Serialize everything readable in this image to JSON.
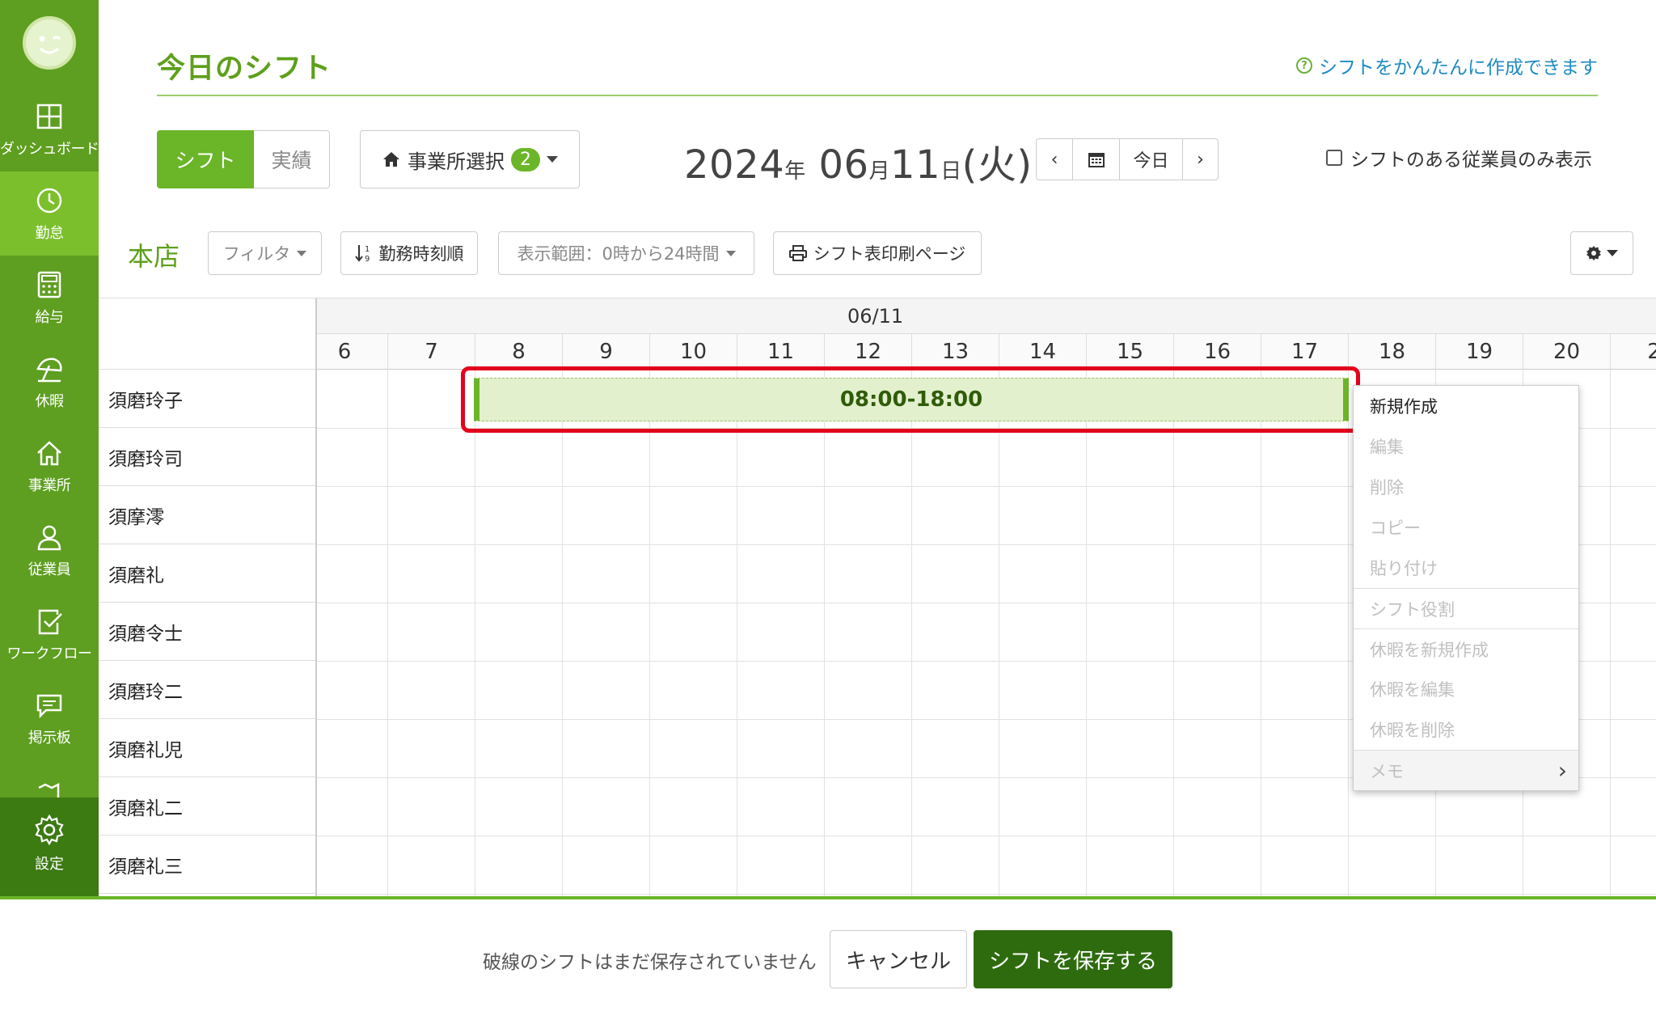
{
  "sidebar": {
    "items": [
      {
        "label": "ダッシュボード",
        "icon": "dashboard-icon"
      },
      {
        "label": "勤怠",
        "icon": "clock-icon"
      },
      {
        "label": "給与",
        "icon": "calculator-icon"
      },
      {
        "label": "休暇",
        "icon": "beach-umbrella-icon"
      },
      {
        "label": "事業所",
        "icon": "home-icon"
      },
      {
        "label": "従業員",
        "icon": "person-icon"
      },
      {
        "label": "ワークフロー",
        "icon": "clipboard-check-icon"
      },
      {
        "label": "掲示板",
        "icon": "message-icon"
      }
    ],
    "settings_label": "設定",
    "active_index": 1
  },
  "header": {
    "title": "今日のシフト",
    "help_link": "シフトをかんたんに作成できます"
  },
  "toolbar": {
    "view_toggle": {
      "shift": "シフト",
      "actual": "実績"
    },
    "office_select": {
      "label": "事業所選択",
      "count": "2"
    },
    "date": {
      "year": "2024",
      "year_unit": "年",
      "month": "06",
      "month_unit": "月",
      "day": "11",
      "day_unit": "日",
      "weekday": "(火)"
    },
    "date_nav": {
      "prev": "‹",
      "today": "今日",
      "next": "›"
    },
    "only_with_shifts": "シフトのある従業員のみ表示",
    "store_name": "本店",
    "filter": "フィルタ",
    "sort": "勤務時刻順",
    "range": "表示範囲：0時から24時間",
    "print": "シフト表印刷ページ"
  },
  "grid": {
    "date": "06/11",
    "hours": [
      "6",
      "7",
      "8",
      "9",
      "10",
      "11",
      "12",
      "13",
      "14",
      "15",
      "16",
      "17",
      "18",
      "19",
      "20",
      "2"
    ],
    "employees": [
      "須磨玲子",
      "須磨玲司",
      "須摩澪",
      "須磨礼",
      "須磨令士",
      "須磨玲二",
      "須磨礼児",
      "須磨礼二",
      "須磨礼三"
    ],
    "shift": {
      "employee": "須磨玲子",
      "label": "08:00-18:00",
      "start": "08:00",
      "end": "18:00"
    }
  },
  "context_menu": {
    "items": [
      {
        "label": "新規作成",
        "enabled": true
      },
      {
        "label": "編集",
        "enabled": false
      },
      {
        "label": "削除",
        "enabled": false
      },
      {
        "label": "コピー",
        "enabled": false
      },
      {
        "label": "貼り付け",
        "enabled": false
      },
      {
        "label": "シフト役割",
        "enabled": false
      },
      {
        "label": "休暇を新規作成",
        "enabled": false
      },
      {
        "label": "休暇を編集",
        "enabled": false
      },
      {
        "label": "休暇を削除",
        "enabled": false
      },
      {
        "label": "メモ",
        "enabled": false
      }
    ]
  },
  "footer": {
    "message": "破線のシフトはまだ保存されていません",
    "cancel": "キャンセル",
    "save": "シフトを保存する"
  },
  "colors": {
    "sidebar": "#5e9e20",
    "sidebar_active": "#7bbf2c",
    "accent": "#6ab528",
    "save_button": "#2e6b0e",
    "highlight": "#e3001b",
    "shift_fill": "#e3f0cd",
    "link": "#1e8bc3"
  }
}
